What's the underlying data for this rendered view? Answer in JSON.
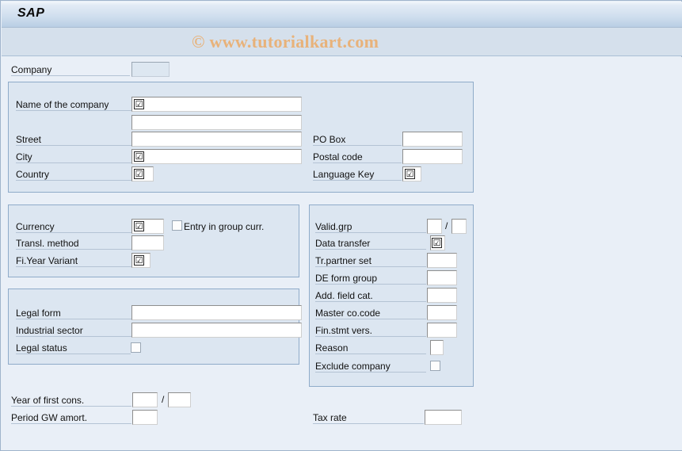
{
  "window": {
    "title": "SAP",
    "watermark": "© www.tutorialkart.com",
    "required_glyph": "☑",
    "slash": "/"
  },
  "colors": {
    "background": "#e9eff7",
    "group_fill": "#dce6f1",
    "group_border": "#8fabc9",
    "titlebar_top": "#f2f6fb",
    "titlebar_bottom": "#b9cee4",
    "toolbar": "#d5e0ec",
    "watermark": "#e8b27a",
    "field_bg": "#ffffff",
    "field_dim_bg": "#dde7f1",
    "label_underline": "#b4c3d4"
  },
  "header_row": {
    "company": {
      "label": "Company",
      "value": "",
      "placeholder": ""
    }
  },
  "group_address": {
    "fields": [
      {
        "label": "Name of the company",
        "value": "",
        "required": true
      },
      {
        "label": "",
        "value": "",
        "required": false
      },
      {
        "label": "Street",
        "value": "",
        "required": false
      },
      {
        "label": "City",
        "value": "",
        "required": true
      },
      {
        "label": "Country",
        "value": "",
        "required": true
      }
    ],
    "right_fields": [
      {
        "label": "PO Box",
        "value": "",
        "required": false
      },
      {
        "label": "Postal code",
        "value": "",
        "required": false
      },
      {
        "label": "Language Key",
        "value": "",
        "required": true
      }
    ]
  },
  "group_currency": {
    "fields": [
      {
        "label": "Currency",
        "value": "",
        "required": true
      },
      {
        "label": "Transl. method",
        "value": "",
        "required": false
      },
      {
        "label": "Fi.Year Variant",
        "value": "",
        "required": true
      }
    ],
    "checkbox": {
      "label": "Entry in group curr.",
      "checked": false
    }
  },
  "group_legal": {
    "fields": [
      {
        "label": "Legal form",
        "value": "",
        "required": false
      },
      {
        "label": "Industrial sector",
        "value": "",
        "required": false
      }
    ],
    "checkbox": {
      "label": "Legal status",
      "checked": false
    }
  },
  "group_control": {
    "valid_grp": {
      "label": "Valid.grp",
      "value_from": "",
      "value_to": ""
    },
    "fields": [
      {
        "label": "Data transfer",
        "value": "",
        "required": true
      },
      {
        "label": "Tr.partner set",
        "value": "",
        "required": false
      },
      {
        "label": "DE form group",
        "value": "",
        "required": false
      },
      {
        "label": "Add. field cat.",
        "value": "",
        "required": false
      },
      {
        "label": "Master co.code",
        "value": "",
        "required": false
      },
      {
        "label": "Fin.stmt vers.",
        "value": "",
        "required": false
      },
      {
        "label": "Reason",
        "value": "",
        "required": false
      }
    ],
    "checkbox": {
      "label": "Exclude company",
      "checked": false
    }
  },
  "footer": {
    "year_of_first_cons": {
      "label": "Year of first cons.",
      "value_from": "",
      "value_to": ""
    },
    "period_gw_amort": {
      "label": "Period GW amort.",
      "value": ""
    },
    "tax_rate": {
      "label": "Tax rate",
      "value": ""
    }
  }
}
